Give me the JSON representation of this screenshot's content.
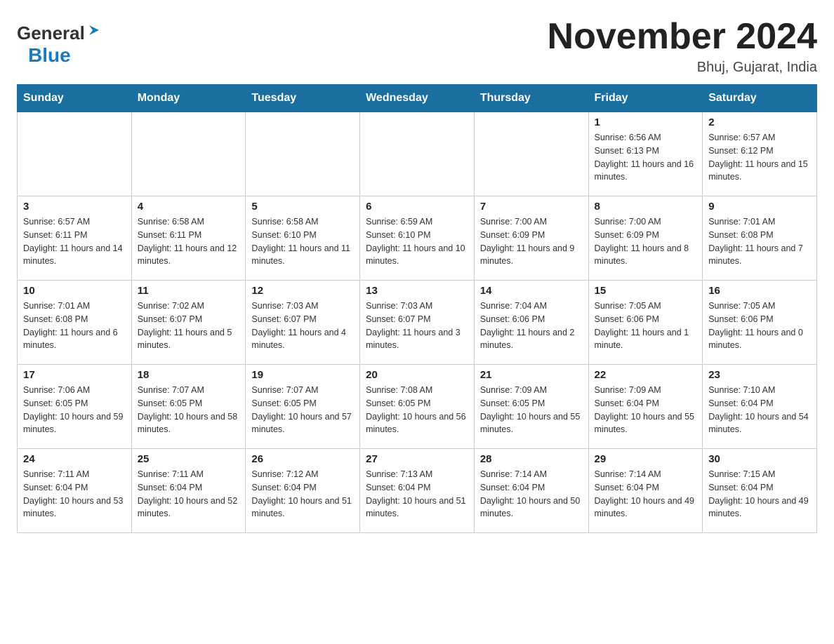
{
  "header": {
    "logo_general": "General",
    "logo_blue": "Blue",
    "month_title": "November 2024",
    "location": "Bhuj, Gujarat, India"
  },
  "weekdays": [
    "Sunday",
    "Monday",
    "Tuesday",
    "Wednesday",
    "Thursday",
    "Friday",
    "Saturday"
  ],
  "weeks": [
    [
      {
        "day": "",
        "sunrise": "",
        "sunset": "",
        "daylight": ""
      },
      {
        "day": "",
        "sunrise": "",
        "sunset": "",
        "daylight": ""
      },
      {
        "day": "",
        "sunrise": "",
        "sunset": "",
        "daylight": ""
      },
      {
        "day": "",
        "sunrise": "",
        "sunset": "",
        "daylight": ""
      },
      {
        "day": "",
        "sunrise": "",
        "sunset": "",
        "daylight": ""
      },
      {
        "day": "1",
        "sunrise": "Sunrise: 6:56 AM",
        "sunset": "Sunset: 6:13 PM",
        "daylight": "Daylight: 11 hours and 16 minutes."
      },
      {
        "day": "2",
        "sunrise": "Sunrise: 6:57 AM",
        "sunset": "Sunset: 6:12 PM",
        "daylight": "Daylight: 11 hours and 15 minutes."
      }
    ],
    [
      {
        "day": "3",
        "sunrise": "Sunrise: 6:57 AM",
        "sunset": "Sunset: 6:11 PM",
        "daylight": "Daylight: 11 hours and 14 minutes."
      },
      {
        "day": "4",
        "sunrise": "Sunrise: 6:58 AM",
        "sunset": "Sunset: 6:11 PM",
        "daylight": "Daylight: 11 hours and 12 minutes."
      },
      {
        "day": "5",
        "sunrise": "Sunrise: 6:58 AM",
        "sunset": "Sunset: 6:10 PM",
        "daylight": "Daylight: 11 hours and 11 minutes."
      },
      {
        "day": "6",
        "sunrise": "Sunrise: 6:59 AM",
        "sunset": "Sunset: 6:10 PM",
        "daylight": "Daylight: 11 hours and 10 minutes."
      },
      {
        "day": "7",
        "sunrise": "Sunrise: 7:00 AM",
        "sunset": "Sunset: 6:09 PM",
        "daylight": "Daylight: 11 hours and 9 minutes."
      },
      {
        "day": "8",
        "sunrise": "Sunrise: 7:00 AM",
        "sunset": "Sunset: 6:09 PM",
        "daylight": "Daylight: 11 hours and 8 minutes."
      },
      {
        "day": "9",
        "sunrise": "Sunrise: 7:01 AM",
        "sunset": "Sunset: 6:08 PM",
        "daylight": "Daylight: 11 hours and 7 minutes."
      }
    ],
    [
      {
        "day": "10",
        "sunrise": "Sunrise: 7:01 AM",
        "sunset": "Sunset: 6:08 PM",
        "daylight": "Daylight: 11 hours and 6 minutes."
      },
      {
        "day": "11",
        "sunrise": "Sunrise: 7:02 AM",
        "sunset": "Sunset: 6:07 PM",
        "daylight": "Daylight: 11 hours and 5 minutes."
      },
      {
        "day": "12",
        "sunrise": "Sunrise: 7:03 AM",
        "sunset": "Sunset: 6:07 PM",
        "daylight": "Daylight: 11 hours and 4 minutes."
      },
      {
        "day": "13",
        "sunrise": "Sunrise: 7:03 AM",
        "sunset": "Sunset: 6:07 PM",
        "daylight": "Daylight: 11 hours and 3 minutes."
      },
      {
        "day": "14",
        "sunrise": "Sunrise: 7:04 AM",
        "sunset": "Sunset: 6:06 PM",
        "daylight": "Daylight: 11 hours and 2 minutes."
      },
      {
        "day": "15",
        "sunrise": "Sunrise: 7:05 AM",
        "sunset": "Sunset: 6:06 PM",
        "daylight": "Daylight: 11 hours and 1 minute."
      },
      {
        "day": "16",
        "sunrise": "Sunrise: 7:05 AM",
        "sunset": "Sunset: 6:06 PM",
        "daylight": "Daylight: 11 hours and 0 minutes."
      }
    ],
    [
      {
        "day": "17",
        "sunrise": "Sunrise: 7:06 AM",
        "sunset": "Sunset: 6:05 PM",
        "daylight": "Daylight: 10 hours and 59 minutes."
      },
      {
        "day": "18",
        "sunrise": "Sunrise: 7:07 AM",
        "sunset": "Sunset: 6:05 PM",
        "daylight": "Daylight: 10 hours and 58 minutes."
      },
      {
        "day": "19",
        "sunrise": "Sunrise: 7:07 AM",
        "sunset": "Sunset: 6:05 PM",
        "daylight": "Daylight: 10 hours and 57 minutes."
      },
      {
        "day": "20",
        "sunrise": "Sunrise: 7:08 AM",
        "sunset": "Sunset: 6:05 PM",
        "daylight": "Daylight: 10 hours and 56 minutes."
      },
      {
        "day": "21",
        "sunrise": "Sunrise: 7:09 AM",
        "sunset": "Sunset: 6:05 PM",
        "daylight": "Daylight: 10 hours and 55 minutes."
      },
      {
        "day": "22",
        "sunrise": "Sunrise: 7:09 AM",
        "sunset": "Sunset: 6:04 PM",
        "daylight": "Daylight: 10 hours and 55 minutes."
      },
      {
        "day": "23",
        "sunrise": "Sunrise: 7:10 AM",
        "sunset": "Sunset: 6:04 PM",
        "daylight": "Daylight: 10 hours and 54 minutes."
      }
    ],
    [
      {
        "day": "24",
        "sunrise": "Sunrise: 7:11 AM",
        "sunset": "Sunset: 6:04 PM",
        "daylight": "Daylight: 10 hours and 53 minutes."
      },
      {
        "day": "25",
        "sunrise": "Sunrise: 7:11 AM",
        "sunset": "Sunset: 6:04 PM",
        "daylight": "Daylight: 10 hours and 52 minutes."
      },
      {
        "day": "26",
        "sunrise": "Sunrise: 7:12 AM",
        "sunset": "Sunset: 6:04 PM",
        "daylight": "Daylight: 10 hours and 51 minutes."
      },
      {
        "day": "27",
        "sunrise": "Sunrise: 7:13 AM",
        "sunset": "Sunset: 6:04 PM",
        "daylight": "Daylight: 10 hours and 51 minutes."
      },
      {
        "day": "28",
        "sunrise": "Sunrise: 7:14 AM",
        "sunset": "Sunset: 6:04 PM",
        "daylight": "Daylight: 10 hours and 50 minutes."
      },
      {
        "day": "29",
        "sunrise": "Sunrise: 7:14 AM",
        "sunset": "Sunset: 6:04 PM",
        "daylight": "Daylight: 10 hours and 49 minutes."
      },
      {
        "day": "30",
        "sunrise": "Sunrise: 7:15 AM",
        "sunset": "Sunset: 6:04 PM",
        "daylight": "Daylight: 10 hours and 49 minutes."
      }
    ]
  ]
}
